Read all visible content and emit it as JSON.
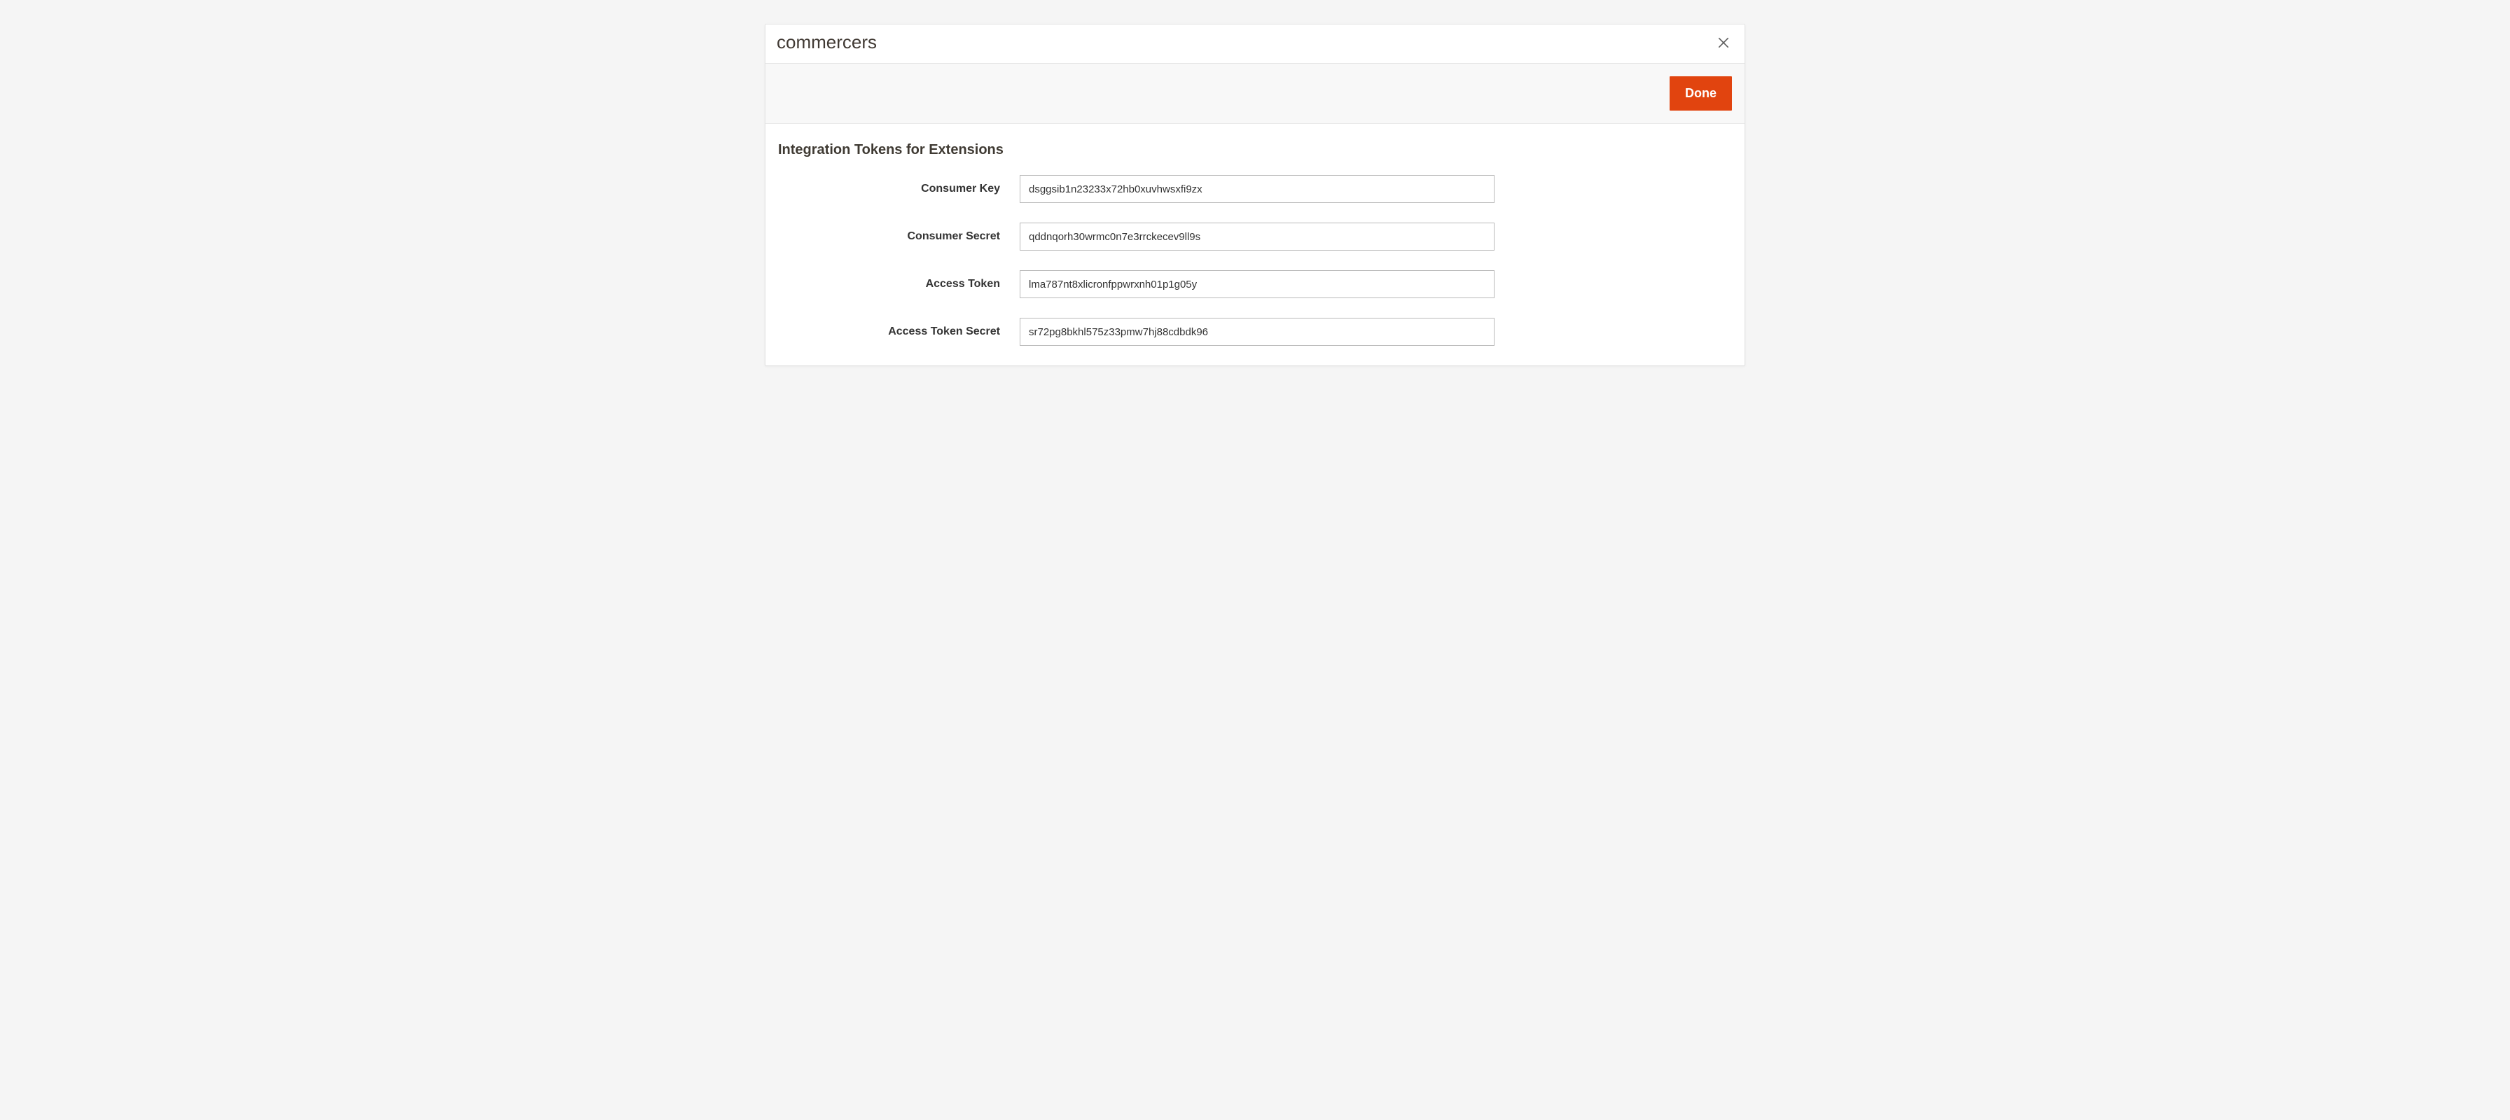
{
  "modal": {
    "title": "commercers",
    "done_label": "Done"
  },
  "section": {
    "title": "Integration Tokens for Extensions"
  },
  "fields": {
    "consumer_key": {
      "label": "Consumer Key",
      "value": "dsggsib1n23233x72hb0xuvhwsxfi9zx"
    },
    "consumer_secret": {
      "label": "Consumer Secret",
      "value": "qddnqorh30wrmc0n7e3rrckecev9ll9s"
    },
    "access_token": {
      "label": "Access Token",
      "value": "lma787nt8xlicronfppwrxnh01p1g05y"
    },
    "access_token_secret": {
      "label": "Access Token Secret",
      "value": "sr72pg8bkhl575z33pmw7hj88cdbdk96"
    }
  }
}
